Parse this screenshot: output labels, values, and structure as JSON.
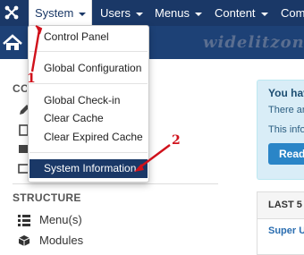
{
  "topbar": {
    "menus": [
      {
        "label": "System",
        "active": true
      },
      {
        "label": "Users"
      },
      {
        "label": "Menus"
      },
      {
        "label": "Content"
      },
      {
        "label": "Com"
      }
    ]
  },
  "watermark": "widelitzone",
  "sidebar": {
    "content_heading_partial": "CO",
    "structure_heading": "STRUCTURE",
    "structure_items": [
      {
        "label": "Menu(s)",
        "icon": "list-icon"
      },
      {
        "label": "Modules",
        "icon": "cube-icon"
      }
    ]
  },
  "dropdown": {
    "items": [
      {
        "label": "Control Panel"
      },
      {
        "label": "Global Configuration"
      },
      {
        "label": "Global Check-in"
      },
      {
        "label": "Clear Cache"
      },
      {
        "label": "Clear Expired Cache"
      },
      {
        "label": "System Information",
        "selected": true
      }
    ]
  },
  "info_panel": {
    "title": "You hav",
    "line1": "There ar",
    "line2": "This info",
    "button": "Read"
  },
  "last_panel": {
    "heading": "LAST 5",
    "row": "Super U"
  },
  "annotations": {
    "step1": "1",
    "step2": "2"
  },
  "colors": {
    "navbar": "#1a3867",
    "subhead": "#1d4176",
    "selected": "#1a3867",
    "annotation": "#d0111b",
    "info_bg": "#d9edf7",
    "button": "#2a85c7"
  }
}
